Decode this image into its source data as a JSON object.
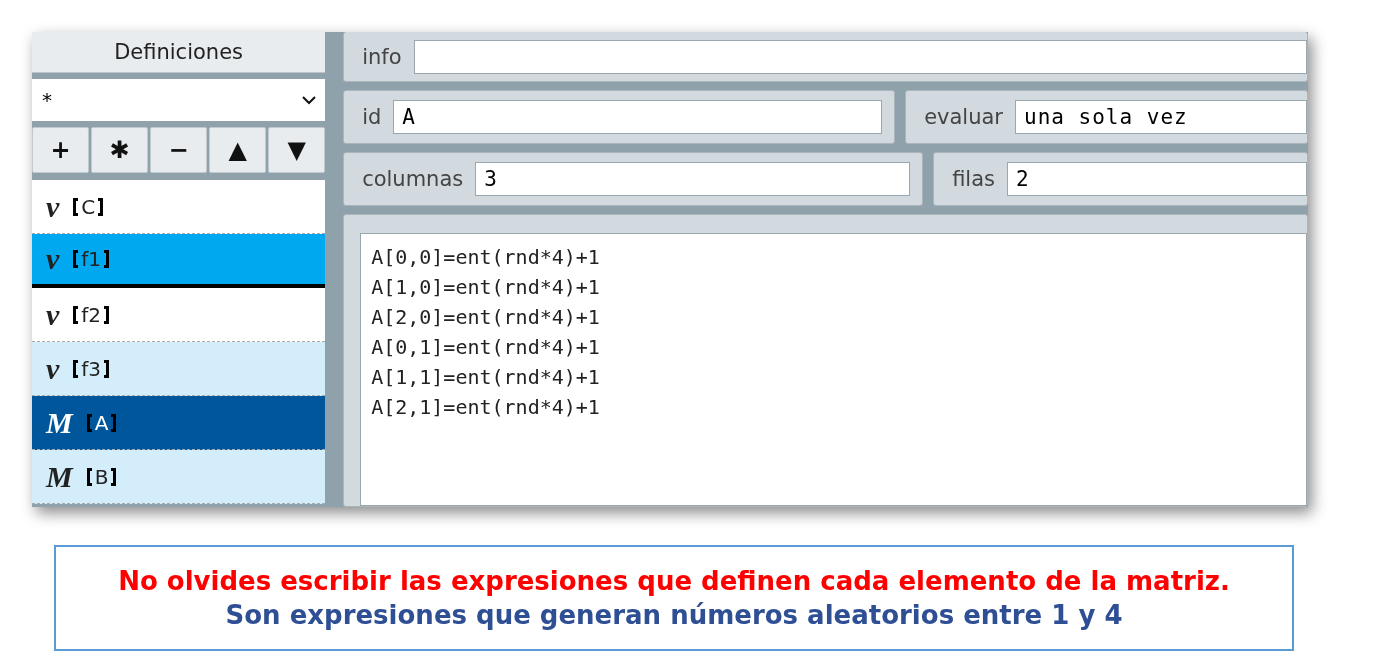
{
  "sidebar": {
    "title": "Definiciones",
    "filter": {
      "value": "*"
    },
    "buttons": [
      {
        "label": "+"
      },
      {
        "label": "✱"
      },
      {
        "label": "−"
      },
      {
        "label": "▲"
      },
      {
        "label": "▼"
      }
    ],
    "items": [
      {
        "symbol": "v",
        "label": "C",
        "selected": false,
        "marked": false,
        "tinted": false
      },
      {
        "symbol": "v",
        "label": "f1",
        "selected": false,
        "marked": true,
        "tinted": false
      },
      {
        "symbol": "v",
        "label": "f2",
        "selected": false,
        "marked": false,
        "tinted": false
      },
      {
        "symbol": "v",
        "label": "f3",
        "selected": false,
        "marked": false,
        "tinted": true
      },
      {
        "symbol": "M",
        "label": "A",
        "selected": true,
        "marked": false,
        "tinted": false
      },
      {
        "symbol": "M",
        "label": "B",
        "selected": false,
        "marked": false,
        "tinted": true
      }
    ]
  },
  "editor": {
    "info": {
      "label": "info"
    },
    "id": {
      "label": "id",
      "value": "A"
    },
    "evaluate": {
      "label": "evaluar",
      "value": "una sola vez"
    },
    "columns": {
      "label": "columnas",
      "value": "3"
    },
    "rows": {
      "label": "filas",
      "value": "2"
    },
    "expressions": [
      "A[0,0]=ent(rnd*4)+1",
      "A[1,0]=ent(rnd*4)+1",
      "A[2,0]=ent(rnd*4)+1",
      "A[0,1]=ent(rnd*4)+1",
      "A[1,1]=ent(rnd*4)+1",
      "A[2,1]=ent(rnd*4)+1"
    ]
  },
  "note": {
    "warning": "No olvides escribir las expresiones que definen cada elemento de la matriz.",
    "explanation": "Son expresiones que generan números aleatorios entre 1 y 4"
  }
}
